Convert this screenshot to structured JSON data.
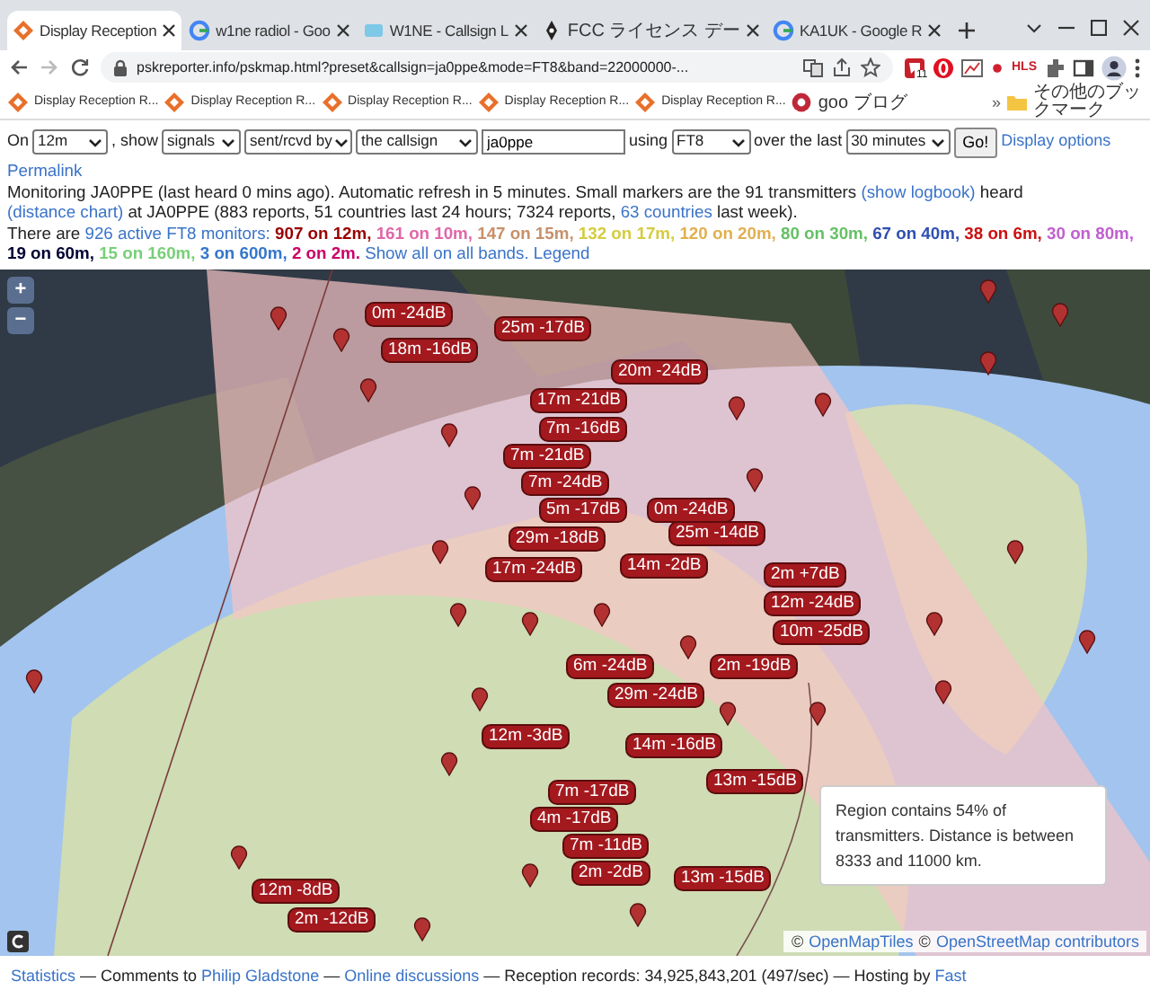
{
  "browser": {
    "tabs": [
      {
        "title": "Display Reception",
        "selected": true
      },
      {
        "title": "w1ne radiol - Goo",
        "selected": false
      },
      {
        "title": "W1NE - Callsign L",
        "selected": false
      },
      {
        "title": "FCC ライセンス デー",
        "selected": false
      },
      {
        "title": "KA1UK - Google R",
        "selected": false
      }
    ],
    "address": "pskreporter.info/pskmap.html?preset&callsign=ja0ppe&mode=FT8&band=22000000-...",
    "extension_badge": "11",
    "extension_label": "HLS",
    "bookmarks": [
      "Display Reception R...",
      "Display Reception R...",
      "Display Reception R...",
      "Display Reception R...",
      "Display Reception R...",
      "goo ブログ"
    ],
    "bookmarks_more": "»",
    "other_bookmarks": "その他のブックマーク"
  },
  "controls": {
    "on_label": "On",
    "band": "12m",
    "show_label": ", show",
    "show": "signals",
    "direction": "sent/rcvd by",
    "target": "the callsign",
    "callsign": "ja0ppe",
    "using_label": "using",
    "mode": "FT8",
    "over_label": "over the last",
    "period": "30 minutes",
    "go": "Go!",
    "display_options": "Display options",
    "permalink": "Permalink"
  },
  "monitoring": [
    {
      "text": "Monitoring JA0PPE (last heard 0 mins ago). Automatic refresh in 5 minutes. Small markers are the 91 transmitters ",
      "kind": "text"
    },
    {
      "text": "(show logbook)",
      "kind": "link"
    },
    {
      "text": " heard ",
      "kind": "text"
    },
    {
      "text": "(distance chart)",
      "kind": "link"
    },
    {
      "text": " at JA0PPE (883 reports, 51 countries last 24 hours; 7324 reports, ",
      "kind": "text"
    },
    {
      "text": "63 countries",
      "kind": "link"
    },
    {
      "text": " last week).",
      "kind": "text"
    }
  ],
  "summary": {
    "prefix": "There are",
    "monitors": "926 active FT8 monitors:",
    "bands": [
      {
        "text": "907 on 12m,",
        "color": "#990000"
      },
      {
        "text": "161 on 10m,",
        "color": "#e066a8"
      },
      {
        "text": "147 on 15m,",
        "color": "#c8906a"
      },
      {
        "text": "132 on 17m,",
        "color": "#d4cc40"
      },
      {
        "text": "120 on 20m,",
        "color": "#e0b050"
      },
      {
        "text": "80 on 30m,",
        "color": "#66c066"
      },
      {
        "text": "67 on 40m,",
        "color": "#3050b0"
      },
      {
        "text": "38 on 6m,",
        "color": "#cc1111"
      },
      {
        "text": "30 on 80m,",
        "color": "#c060d0"
      },
      {
        "text": "19 on 60m,",
        "color": "#000033"
      },
      {
        "text": "15 on 160m,",
        "color": "#77d077"
      },
      {
        "text": "3 on 600m,",
        "color": "#3377cc"
      },
      {
        "text": "2 on 2m.",
        "color": "#cc0066"
      }
    ],
    "show_all": "Show all on all bands.",
    "legend": "Legend"
  },
  "map": {
    "zoom_in": "+",
    "zoom_out": "−",
    "labels": [
      "0m -24dB",
      "25m -17dB",
      "18m -16dB",
      "20m -24dB",
      "17m -21dB",
      "7m -16dB",
      "7m -21dB",
      "7m -24dB",
      "5m -17dB",
      "0m -24dB",
      "29m -18dB",
      "25m -14dB",
      "14m -2dB",
      "17m -24dB",
      "2m +7dB",
      "12m -24dB",
      "10m -25dB",
      "6m -24dB",
      "2m -19dB",
      "29m -24dB",
      "12m -3dB",
      "14m -16dB",
      "13m -15dB",
      "7m -17dB",
      "4m -17dB",
      "7m -11dB",
      "2m -2dB",
      "13m -15dB",
      "12m -8dB",
      "2m -12dB"
    ],
    "tooltip": "Region contains 54% of transmitters. Distance is between 8333 and 11000 km.",
    "attribution": [
      {
        "text": "©",
        "kind": "text"
      },
      {
        "text": "OpenMapTiles",
        "kind": "link"
      },
      {
        "text": "©",
        "kind": "text"
      },
      {
        "text": "OpenStreetMap contributors",
        "kind": "link"
      }
    ]
  },
  "footer": [
    {
      "text": "Statistics",
      "kind": "link"
    },
    {
      "text": " — Comments to ",
      "kind": "text"
    },
    {
      "text": "Philip Gladstone",
      "kind": "link"
    },
    {
      "text": " — ",
      "kind": "text"
    },
    {
      "text": "Online discussions",
      "kind": "link"
    },
    {
      "text": " — Reception records: 34,925,843,201 (497/sec) — Hosting by ",
      "kind": "text"
    },
    {
      "text": "Fast",
      "kind": "link"
    }
  ]
}
